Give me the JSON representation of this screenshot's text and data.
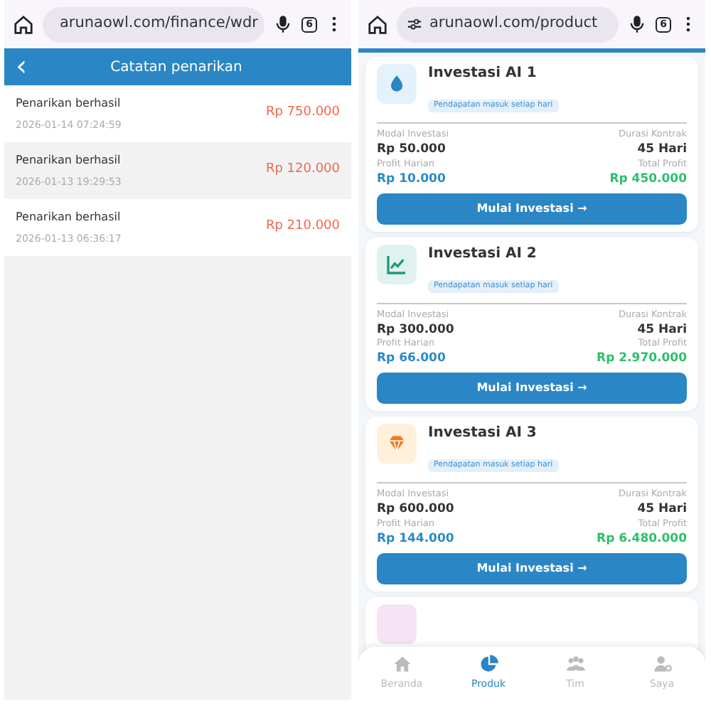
{
  "screens": [
    {
      "browser": {
        "url": "arunaowl.com/finance/wdr",
        "tab_count": "6"
      },
      "header": {
        "back": "‹",
        "title": "Catatan penarikan"
      },
      "withdrawals": [
        {
          "status": "Penarikan berhasil",
          "time": "2026-01-14 07:24:59",
          "amount": "Rp 750.000",
          "selected": false
        },
        {
          "status": "Penarikan berhasil",
          "time": "2026-01-13 19:29:53",
          "amount": "Rp 120.000",
          "selected": true
        },
        {
          "status": "Penarikan berhasil",
          "time": "2026-01-13 06:36:17",
          "amount": "Rp 210.000",
          "selected": false
        }
      ]
    },
    {
      "browser": {
        "url": "arunaowl.com/product",
        "tab_count": "6"
      },
      "products": [
        {
          "kind": "drop",
          "color": "#e3f2fd",
          "title": "Investasi AI 1",
          "badge": "Pendapatan masuk setiap hari",
          "capital_label": "Modal Investasi",
          "capital": "Rp 50.000",
          "duration_label": "Durasi Kontrak",
          "duration": "45 Hari",
          "daily_label": "Profit Harian",
          "daily": "Rp 10.000",
          "total_label": "Total Profit",
          "total": "Rp 450.000",
          "button": "Mulai Investasi →"
        },
        {
          "kind": "chart",
          "color": "#e0f2ef",
          "title": "Investasi AI 2",
          "badge": "Pendapatan masuk setiap hari",
          "capital_label": "Modal Investasi",
          "capital": "Rp 300.000",
          "duration_label": "Durasi Kontrak",
          "duration": "45 Hari",
          "daily_label": "Profit Harian",
          "daily": "Rp 66.000",
          "total_label": "Total Profit",
          "total": "Rp 2.970.000",
          "button": "Mulai Investasi →"
        },
        {
          "kind": "gem",
          "color": "#fff0dc",
          "title": "Investasi AI 3",
          "badge": "Pendapatan masuk setiap hari",
          "capital_label": "Modal Investasi",
          "capital": "Rp 600.000",
          "duration_label": "Durasi Kontrak",
          "duration": "45 Hari",
          "daily_label": "Profit Harian",
          "daily": "Rp 144.000",
          "total_label": "Total Profit",
          "total": "Rp 6.480.000",
          "button": "Mulai Investasi →"
        },
        {
          "kind": "partial",
          "color": "#f6e3f3"
        }
      ],
      "bottom_nav": [
        {
          "kind": "home",
          "label": "Beranda",
          "selected": false
        },
        {
          "kind": "pie",
          "label": "Produk",
          "selected": true
        },
        {
          "kind": "team",
          "label": "Tim",
          "selected": false
        },
        {
          "kind": "user",
          "label": "Saya",
          "selected": false
        }
      ]
    }
  ]
}
